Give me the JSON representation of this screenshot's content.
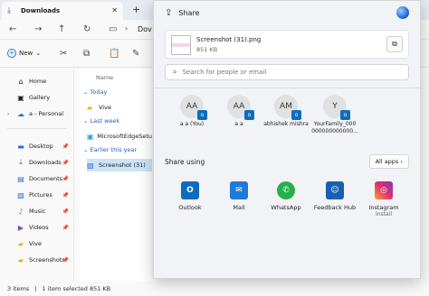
{
  "explorer": {
    "tab_title": "Downloads",
    "address_fragment": "Dov",
    "new_label": "New",
    "sidebar": {
      "home": "Home",
      "gallery": "Gallery",
      "personal": "a - Personal",
      "desktop": "Desktop",
      "downloads": "Downloads",
      "documents": "Documents",
      "pictures": "Pictures",
      "music": "Music",
      "videos": "Videos",
      "vive": "Vive",
      "screenshots": "Screenshots"
    },
    "filelist": {
      "column_header": "Name",
      "group_today": "Today",
      "group_last_week": "Last week",
      "group_earlier": "Earlier this year",
      "files": [
        "Vive",
        "MicrosoftEdgeSetu",
        "Screenshot (31)"
      ]
    },
    "status": {
      "items": "3 items",
      "selected": "1 item selected  851 KB"
    }
  },
  "share": {
    "title": "Share",
    "file_name": "Screenshot (31).png",
    "file_size": "851 KB",
    "search_placeholder": "Search for people or email",
    "contacts": [
      {
        "initials": "AA",
        "name": "a a (You)"
      },
      {
        "initials": "AA",
        "name": "a a"
      },
      {
        "initials": "AM",
        "name": "abhishek mishra"
      },
      {
        "initials": "Y",
        "name": "YourFamily_000 000000000000..."
      }
    ],
    "share_using": "Share using",
    "all_apps": "All apps",
    "apps": [
      {
        "name": "Outlook",
        "sub": ""
      },
      {
        "name": "Mail",
        "sub": ""
      },
      {
        "name": "WhatsApp",
        "sub": ""
      },
      {
        "name": "Feedback Hub",
        "sub": ""
      },
      {
        "name": "Instagram",
        "sub": "Install"
      }
    ]
  }
}
